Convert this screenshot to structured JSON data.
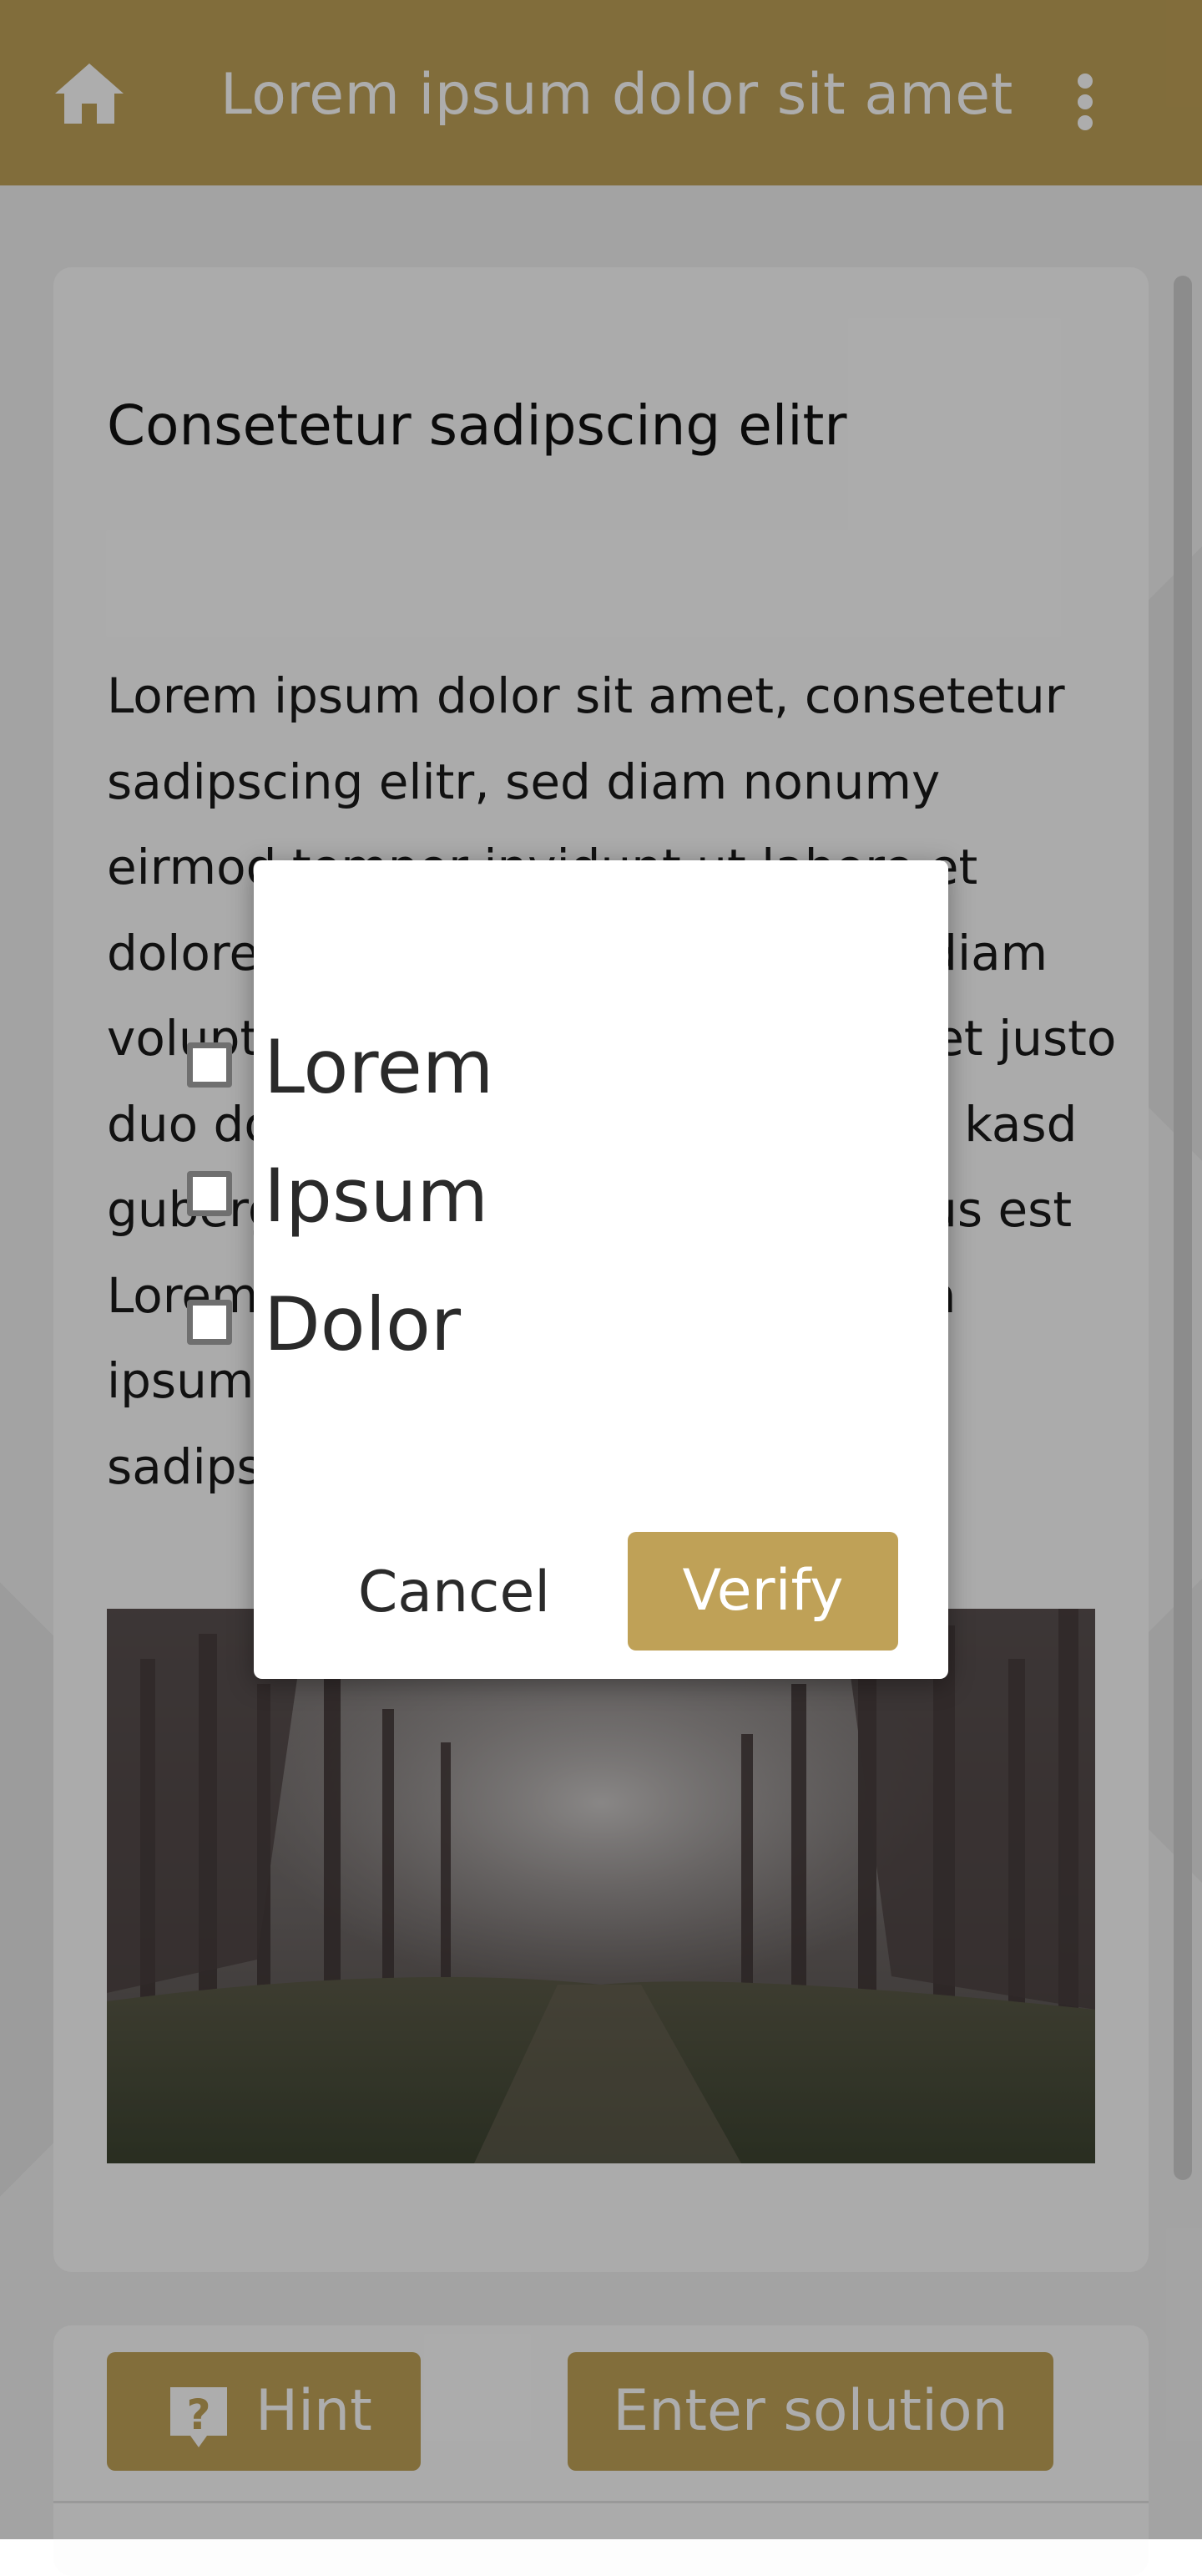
{
  "app_bar": {
    "title": "Lorem ipsum dolor sit amet",
    "home_icon": "home-icon",
    "menu_icon": "more-vert-icon"
  },
  "card": {
    "title": "Consetetur sadipscing elitr",
    "body": "Lorem ipsum dolor sit amet, consetetur sadipscing elitr, sed diam nonumy eirmod tempor invidunt ut labore et dolore magna aliquyam erat, sed diam voluptua. At vero eos et accusam et justo duo dolores et ea rebum. Stet clita kasd gubergren, no sea takimata sanctus est Lorem ipsum dolor sit amet. Lorem ipsum dolor sit amet, consetetur sadipscing elitr",
    "image": "forest-photo"
  },
  "bottom_bar": {
    "hint_label": "Hint",
    "hint_icon": "help-icon",
    "solution_label": "Enter solution"
  },
  "dialog": {
    "options": [
      {
        "label": "Lorem",
        "checked": false
      },
      {
        "label": "Ipsum",
        "checked": false
      },
      {
        "label": "Dolor",
        "checked": false
      }
    ],
    "cancel_label": "Cancel",
    "verify_label": "Verify"
  },
  "colors": {
    "accent": "#bfa157",
    "scrim": "rgba(0,0,0,0.32)",
    "page_background": "#f1f1f1"
  }
}
